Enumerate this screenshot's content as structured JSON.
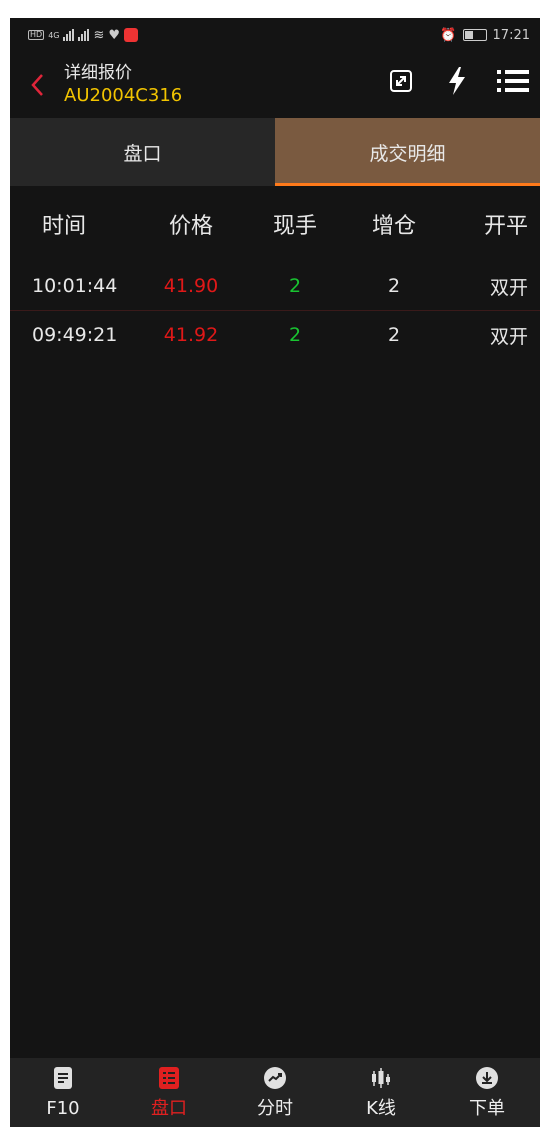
{
  "status_bar": {
    "network": "4G",
    "time": "17:21"
  },
  "header": {
    "title": "详细报价",
    "code": "AU2004C316"
  },
  "tabs": [
    {
      "label": "盘口",
      "active": false
    },
    {
      "label": "成交明细",
      "active": true
    }
  ],
  "table": {
    "columns": [
      "时间",
      "价格",
      "现手",
      "增仓",
      "开平"
    ],
    "rows": [
      {
        "time": "10:01:44",
        "price": "41.90",
        "volume": "2",
        "oi_change": "2",
        "type": "双开"
      },
      {
        "time": "09:49:21",
        "price": "41.92",
        "volume": "2",
        "oi_change": "2",
        "type": "双开"
      }
    ]
  },
  "bottom_nav": [
    {
      "label": "F10",
      "icon": "document-icon",
      "active": false
    },
    {
      "label": "盘口",
      "icon": "orderbook-icon",
      "active": true
    },
    {
      "label": "分时",
      "icon": "timeshare-chart-icon",
      "active": false
    },
    {
      "label": "K线",
      "icon": "candlestick-icon",
      "active": false
    },
    {
      "label": "下单",
      "icon": "order-download-icon",
      "active": false
    }
  ],
  "colors": {
    "background": "#141414",
    "accent_tab": "#7a5a40",
    "tab_underline": "#ff7a1a",
    "code_yellow": "#f2c400",
    "price_red": "#e01818",
    "volume_green": "#19c431"
  }
}
